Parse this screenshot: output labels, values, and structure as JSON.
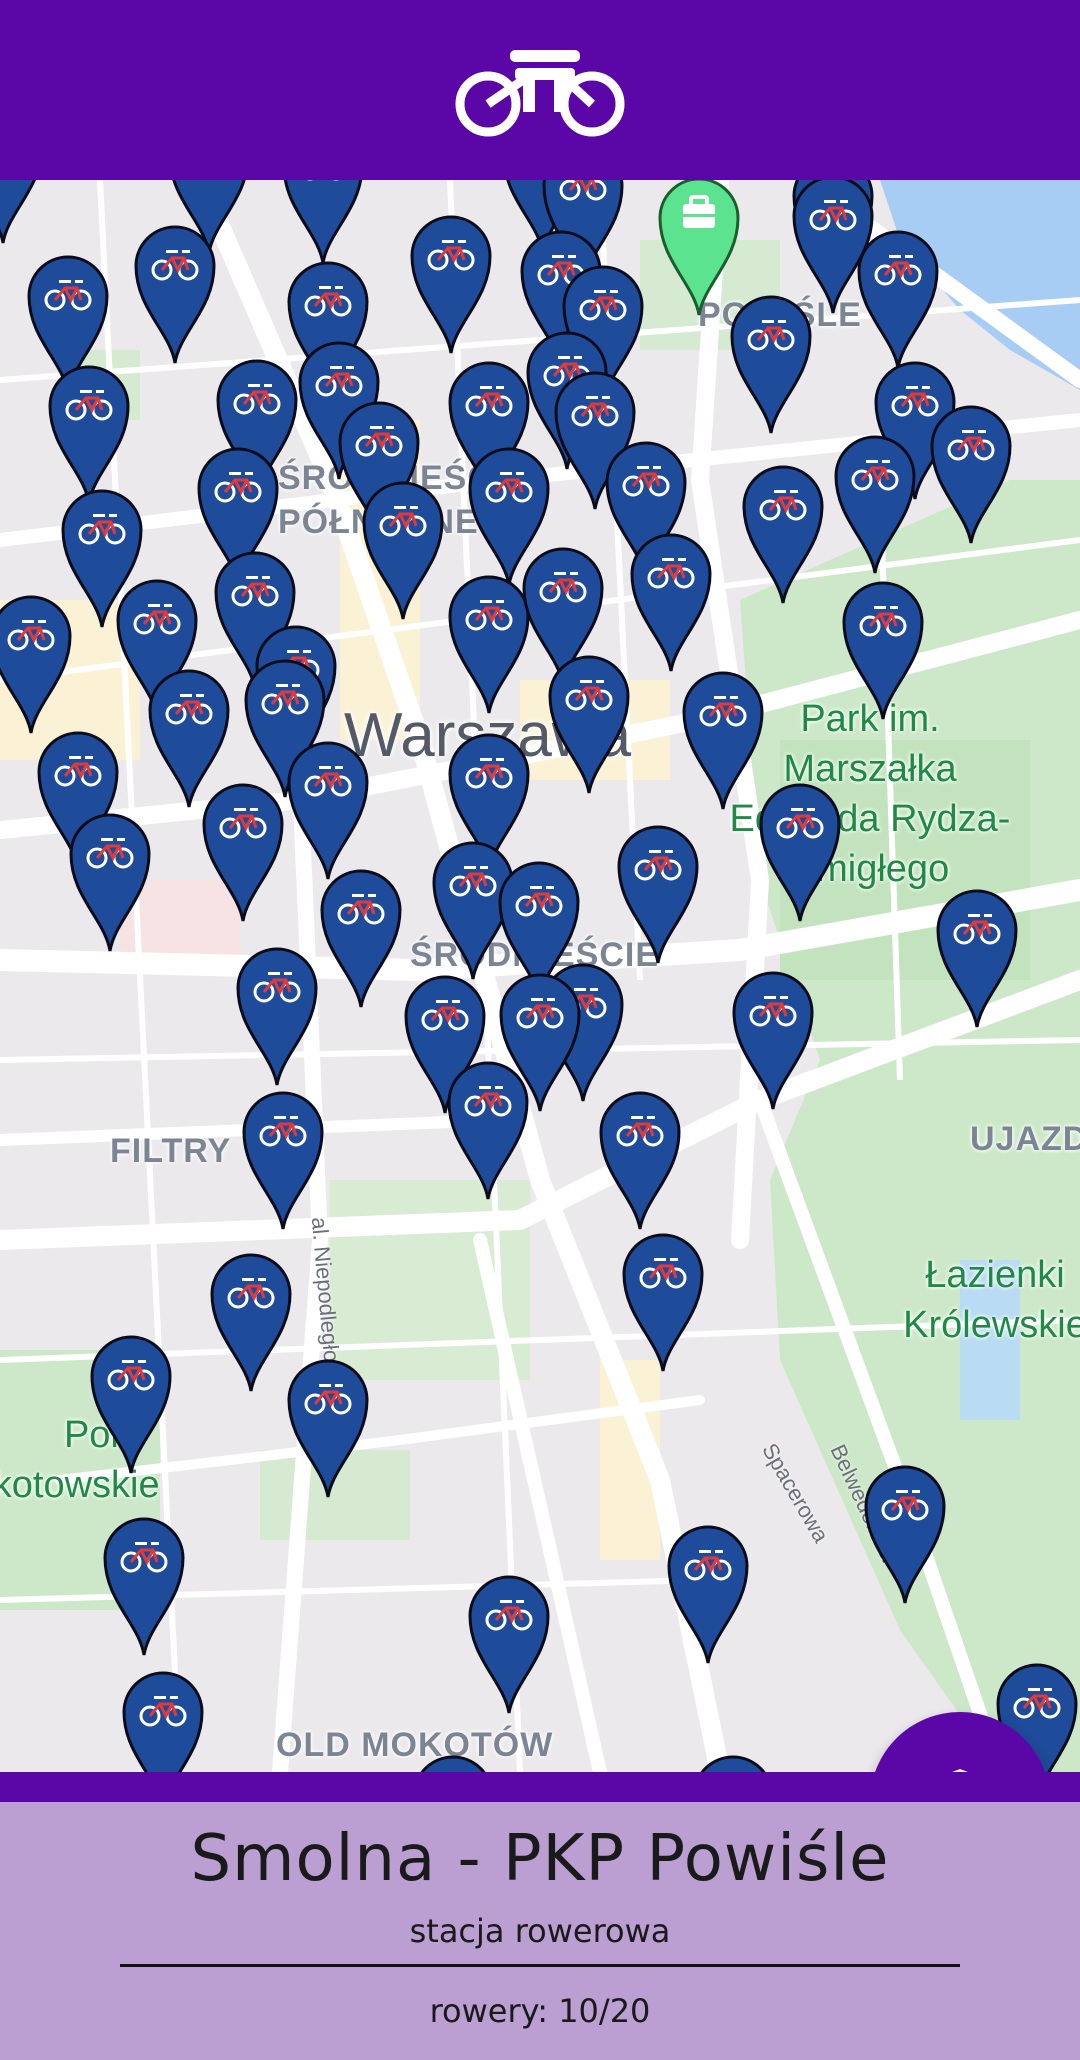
{
  "header": {
    "logo_icon": "bicycle-icon",
    "color": "#5b07a8"
  },
  "map": {
    "district_labels": [
      "POWIŚLE",
      "ŚRÓDMIEŚCIE PÓŁNOCNE",
      "FILTRY",
      "ŚRÓDMIEŚCIE",
      "OLD MOKOTÓW",
      "UJAZDÓW"
    ],
    "city_label": "Warszawa",
    "park_labels": [
      "Park im. Marszałka Edwarda Rydza-Śmigłego",
      "Łazienki Królewskie",
      "Pole Mokotowskie"
    ],
    "street_labels": [
      "Spacerowa",
      "Belwederska",
      "al. Niepodległości"
    ],
    "pin_icon": "bike-station-pin-icon",
    "pin_color": "#1e4b9a",
    "selected_pin_color": "#5ce38f"
  },
  "fab": {
    "icon": "shield-alert-icon"
  },
  "station": {
    "name": "Smolna - PKP Powiśle",
    "type": "stacja rowerowa",
    "bikes_label": "rowery: 10/20"
  },
  "colors": {
    "primary": "#5b07a8",
    "panel": "#bb9fd3"
  }
}
